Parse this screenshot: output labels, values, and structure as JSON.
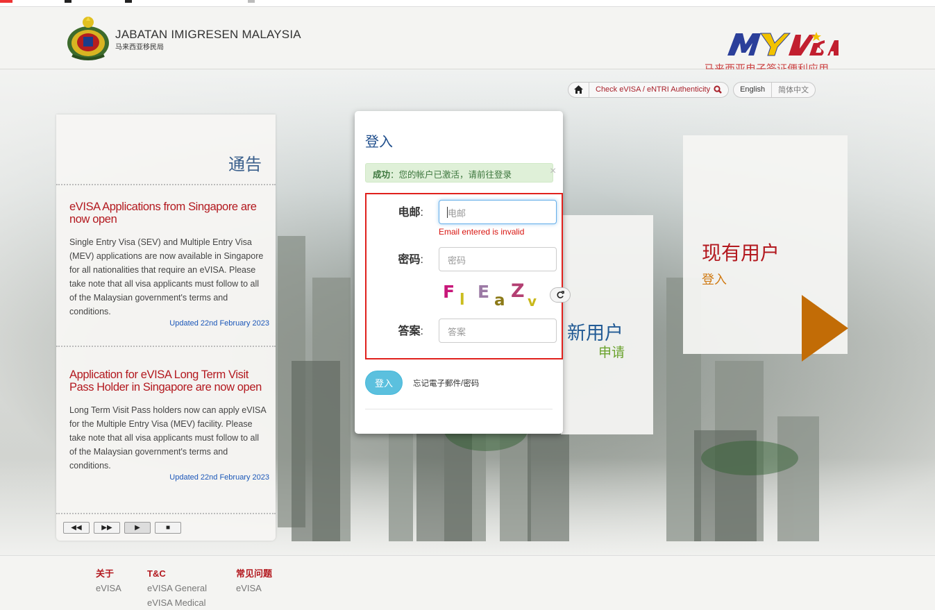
{
  "header": {
    "agency_name": "JABATAN IMIGRESEN MALAYSIA",
    "agency_sub": "马来西亚移民局",
    "brand_sub": "马来西亚电子签证便利应用"
  },
  "toolbar": {
    "check_label": "Check eVISA / eNTRI Authenticity",
    "english": "English",
    "chinese": "简体中文"
  },
  "notice": {
    "title": "通告",
    "items": [
      {
        "title": "eVISA Applications from Singapore are now open",
        "body": "Single Entry Visa (SEV) and Multiple Entry Visa (MEV) applications are now available in Singapore for all nationalities that require an eVISA. Please take note that all visa applicants must follow to all of the Malaysian government's terms and conditions.",
        "updated": "Updated 22nd February 2023"
      },
      {
        "title": "Application for eVISA Long Term Visit Pass Holder in Singapore are now open",
        "body": "Long Term Visit Pass holders now can apply eVISA for the Multiple Entry Visa (MEV) facility. Please take note that all visa applicants must follow to all of the Malaysian government's terms and conditions.",
        "updated": "Updated 22nd February 2023"
      }
    ]
  },
  "panels": {
    "new_user_title": "新用户",
    "new_user_sub": "申请",
    "existing_title": "现有用户",
    "existing_sub": "登入"
  },
  "modal": {
    "title": "登入",
    "alert_bold": "成功",
    "alert_text": "：您的帐户已激活，请前往登录",
    "alert_close": "×",
    "email_label": "电邮",
    "email_placeholder": "电邮",
    "email_error": "Email entered is invalid",
    "password_label": "密码",
    "password_placeholder": "密码",
    "answer_label": "答案",
    "answer_placeholder": "答案",
    "captcha_chars": [
      "F",
      "l",
      "E",
      "a",
      "Z",
      "v"
    ],
    "login_button": "登入",
    "forgot_link": "忘记電子郵件/密码"
  },
  "footer": {
    "columns": [
      {
        "heading": "关于",
        "links": [
          "eVISA"
        ]
      },
      {
        "heading": "T&C",
        "links": [
          "eVISA General",
          "eVISA Medical"
        ]
      },
      {
        "heading": "常见问题",
        "links": [
          "eVISA"
        ]
      }
    ]
  },
  "colors": {
    "brand_red": "#b3191f",
    "link_blue": "#1a56b8",
    "accent_orange": "#c26c06",
    "login_button": "#5bc0de",
    "error_red": "#d8140f"
  },
  "icons": [
    "home-icon",
    "search-icon",
    "refresh-icon",
    "rewind-icon",
    "forward-icon",
    "play-icon",
    "stop-icon",
    "close-icon"
  ]
}
